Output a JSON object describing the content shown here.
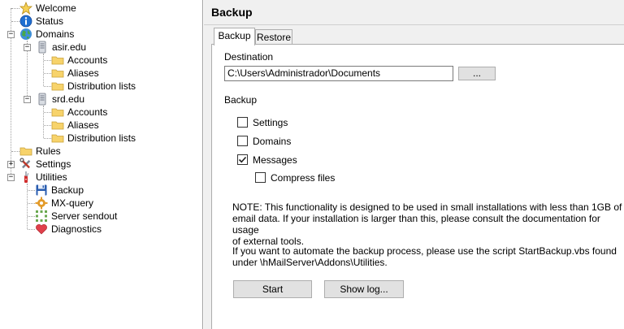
{
  "tree": {
    "welcome": "Welcome",
    "status": "Status",
    "domains": "Domains",
    "domain1": {
      "name": "asir.edu",
      "accounts": "Accounts",
      "aliases": "Aliases",
      "distribution_lists": "Distribution lists"
    },
    "domain2": {
      "name": "srd.edu",
      "accounts": "Accounts",
      "aliases": "Aliases",
      "distribution_lists": "Distribution lists"
    },
    "rules": "Rules",
    "settings": "Settings",
    "utilities": "Utilities",
    "backup": "Backup",
    "mx_query": "MX-query",
    "server_sendout": "Server sendout",
    "diagnostics": "Diagnostics",
    "expander_plus": "+",
    "expander_minus": "−"
  },
  "header": {
    "title": "Backup"
  },
  "tabs": {
    "backup": "Backup",
    "restore": "Restore"
  },
  "destination": {
    "label": "Destination",
    "value": "C:\\Users\\Administrador\\Documents",
    "browse_label": "..."
  },
  "backup_group": {
    "label": "Backup",
    "settings": {
      "label": "Settings",
      "checked": false
    },
    "domains": {
      "label": "Domains",
      "checked": false
    },
    "messages": {
      "label": "Messages",
      "checked": true
    },
    "compress": {
      "label": "Compress files",
      "checked": false
    }
  },
  "notes": {
    "note_line1": "NOTE: This functionality is designed to be used in small installations with less than 1GB of",
    "note_line2": "email data. If your  installation is larger than this, please consult the documentation for usage",
    "note_line3": "of external tools.",
    "automate_line1": "If you want to automate the backup process, please use the script StartBackup.vbs found",
    "automate_line2": "under \\hMailServer\\Addons\\Utilities."
  },
  "buttons": {
    "start": "Start",
    "show_log": "Show log..."
  },
  "icons": {
    "welcome": "star-icon",
    "status": "info-icon",
    "domains": "globe-icon",
    "domain": "server-icon",
    "folder": "folder-icon",
    "settings": "tools-icon",
    "utilities": "pocketknife-icon",
    "backup": "floppy-disk-icon",
    "mx_query": "gear-icon",
    "server_sendout": "dots-icon",
    "diagnostics": "heart-icon"
  },
  "colors": {
    "folder": "#f7d36b",
    "info": "#1f6fd1",
    "heart": "#e0404a",
    "floppy": "#2a5db0"
  }
}
